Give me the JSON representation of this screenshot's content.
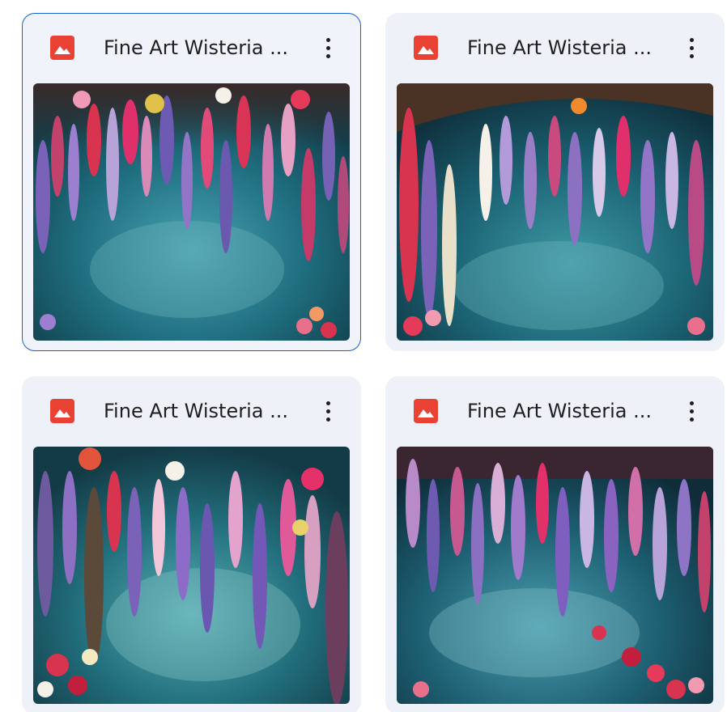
{
  "files": [
    {
      "title": "Fine Art Wisteria ...",
      "selected": true,
      "icon": "image-file-icon"
    },
    {
      "title": "Fine Art Wisteria ...",
      "selected": false,
      "icon": "image-file-icon"
    },
    {
      "title": "Fine Art Wisteria ...",
      "selected": false,
      "icon": "image-file-icon"
    },
    {
      "title": "Fine Art Wisteria ...",
      "selected": false,
      "icon": "image-file-icon"
    }
  ],
  "colors": {
    "card_bg": "#eef1f7",
    "selected_border": "#1a5fd6",
    "file_icon": "#e94235",
    "title_text": "#1f1f1f"
  }
}
